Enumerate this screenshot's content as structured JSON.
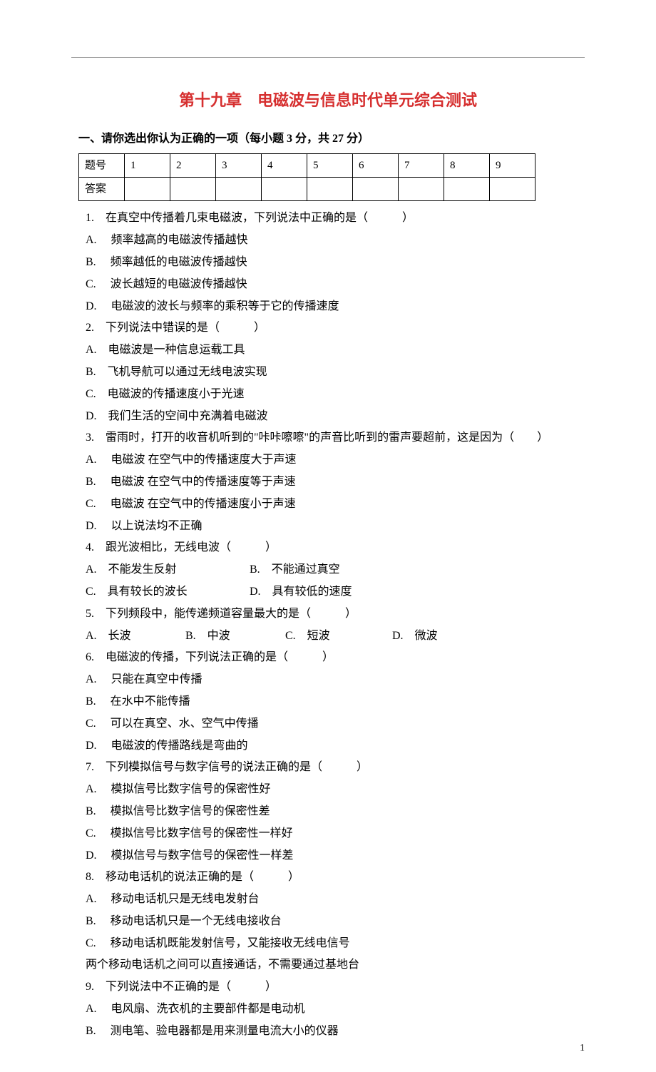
{
  "title": "第十九章　电磁波与信息时代单元综合测试",
  "section1_head": "一、请你选出你认为正确的一项（每小题 3 分，共 27 分）",
  "table": {
    "row_label_1": "题号",
    "row_label_2": "答案",
    "cols": [
      "1",
      "2",
      "3",
      "4",
      "5",
      "6",
      "7",
      "8",
      "9"
    ]
  },
  "questions": [
    {
      "stem": "1.　在真空中传播着几束电磁波，下列说法中正确的是（　　　）",
      "opts": [
        "A.　 频率越高的电磁波传播越快",
        "B.　 频率越低的电磁波传播越快",
        "C.　 波长越短的电磁波传播越快",
        "D.　 电磁波的波长与频率的乘积等于它的传播速度"
      ]
    },
    {
      "stem": "2.　下列说法中错误的是（　　　）",
      "opts": [
        "A.　电磁波是一种信息运载工具",
        "B.　飞机导航可以通过无线电波实现",
        "C.　电磁波的传播速度小于光速",
        "D.　我们生活的空间中充满着电磁波"
      ]
    },
    {
      "stem": "3.　雷雨时，打开的收音机听到的\"咔咔嚓嚓\"的声音比听到的雷声要超前，这是因为（　　）",
      "opts": [
        "A.　 电磁波 在空气中的传播速度大于声速",
        "B.　 电磁波 在空气中的传播速度等于声速",
        "C.　 电磁波 在空气中的传播速度小于声速",
        "D.　 以上说法均不正确"
      ]
    },
    {
      "stem": "4.　跟光波相比，无线电波（　　　）",
      "inline_opts": [
        {
          "a": "A.　不能发生反射",
          "b": "B.　不能通过真空"
        },
        {
          "a": "C.　具有较长的波长",
          "b": "D.　具有较低的速度"
        }
      ]
    },
    {
      "stem": "5.　下列频段中，能传递频道容量最大的是（　　　）",
      "inline_opts": [
        {
          "a": "A.　长波",
          "b": "B.　中波",
          "c": "C.　短波",
          "d": "D.　微波"
        }
      ]
    },
    {
      "stem": "6.　电磁波的传播，下列说法正确的是（　　　）",
      "opts": [
        "A.　 只能在真空中传播",
        "B.　 在水中不能传播",
        "C.　 可以在真空、水、空气中传播",
        "D.　 电磁波的传播路线是弯曲的"
      ]
    },
    {
      "stem": "7.　下列模拟信号与数字信号的说法正确的是（　　　）",
      "opts": [
        "A.　 模拟信号比数字信号的保密性好",
        "B.　 模拟信号比数字信号的保密性差",
        "C.　 模拟信号比数字信号的保密性一样好",
        "D.　 模拟信号与数字信号的保密性一样差"
      ]
    },
    {
      "stem": "8.　移动电话机的说法正确的是（　　　）",
      "opts": [
        "A.　 移动电话机只是无线电发射台",
        "B.　 移动电话机只是一个无线电接收台",
        "C.　 移动电话机既能发射信号，又能接收无线电信号",
        "两个移动电话机之间可以直接通话，不需要通过基地台"
      ]
    },
    {
      "stem": "9.　下列说法中不正确的是（　　　）",
      "opts": [
        "A.　 电风扇、洗衣机的主要部件都是电动机",
        "B.　 测电笔、验电器都是用来测量电流大小的仪器"
      ]
    }
  ],
  "page_num": "1"
}
